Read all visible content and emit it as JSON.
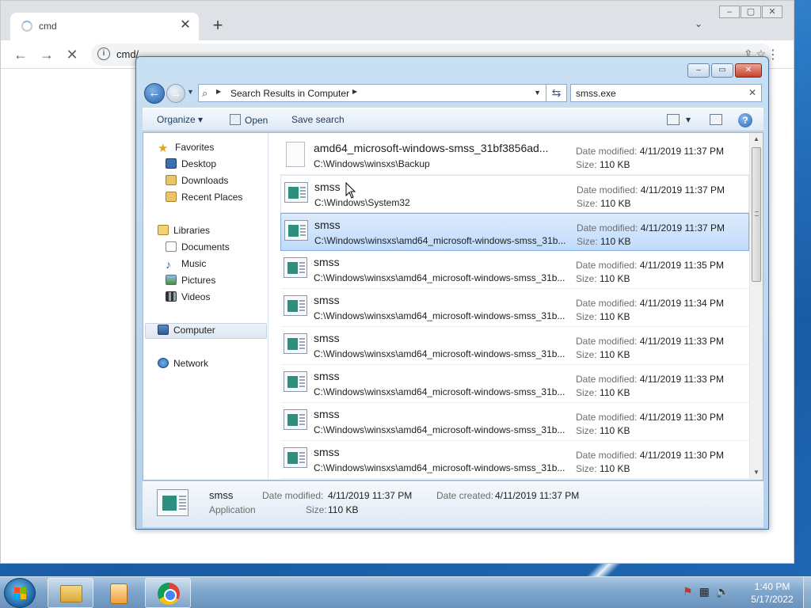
{
  "browser": {
    "tab_title": "cmd",
    "tab_close": "✕",
    "new_tab": "+",
    "tab_dropdown": "⌄",
    "url": "cmd/",
    "info_icon": "i"
  },
  "explorer": {
    "address_crumb": "Search Results in Computer",
    "search_value": "smss.exe",
    "toolbar": {
      "organize": "Organize",
      "open": "Open",
      "save_search": "Save search"
    },
    "nav": {
      "favorites": "Favorites",
      "desktop": "Desktop",
      "downloads": "Downloads",
      "recent_places": "Recent Places",
      "libraries": "Libraries",
      "documents": "Documents",
      "music": "Music",
      "pictures": "Pictures",
      "videos": "Videos",
      "computer": "Computer",
      "network": "Network"
    },
    "meta_labels": {
      "date_modified": "Date modified:",
      "size": "Size:"
    },
    "results": [
      {
        "name": "amd64_microsoft-windows-smss_31bf3856ad...",
        "path": "C:\\Windows\\winsxs\\Backup",
        "date": "4/11/2019 11:37 PM",
        "size": "110 KB"
      },
      {
        "name": "smss",
        "path": "C:\\Windows\\System32",
        "date": "4/11/2019 11:37 PM",
        "size": "110 KB"
      },
      {
        "name": "smss",
        "path": "C:\\Windows\\winsxs\\amd64_microsoft-windows-smss_31b...",
        "date": "4/11/2019 11:37 PM",
        "size": "110 KB"
      },
      {
        "name": "smss",
        "path": "C:\\Windows\\winsxs\\amd64_microsoft-windows-smss_31b...",
        "date": "4/11/2019 11:35 PM",
        "size": "110 KB"
      },
      {
        "name": "smss",
        "path": "C:\\Windows\\winsxs\\amd64_microsoft-windows-smss_31b...",
        "date": "4/11/2019 11:34 PM",
        "size": "110 KB"
      },
      {
        "name": "smss",
        "path": "C:\\Windows\\winsxs\\amd64_microsoft-windows-smss_31b...",
        "date": "4/11/2019 11:33 PM",
        "size": "110 KB"
      },
      {
        "name": "smss",
        "path": "C:\\Windows\\winsxs\\amd64_microsoft-windows-smss_31b...",
        "date": "4/11/2019 11:33 PM",
        "size": "110 KB"
      },
      {
        "name": "smss",
        "path": "C:\\Windows\\winsxs\\amd64_microsoft-windows-smss_31b...",
        "date": "4/11/2019 11:30 PM",
        "size": "110 KB"
      },
      {
        "name": "smss",
        "path": "C:\\Windows\\winsxs\\amd64_microsoft-windows-smss_31b...",
        "date": "4/11/2019 11:30 PM",
        "size": "110 KB"
      }
    ],
    "details": {
      "name": "smss",
      "type": "Application",
      "date_modified_label": "Date modified:",
      "date_modified": "4/11/2019 11:37 PM",
      "date_created_label": "Date created:",
      "date_created": "4/11/2019 11:37 PM",
      "size_label": "Size:",
      "size": "110 KB"
    }
  },
  "taskbar": {
    "time": "1:40 PM",
    "date": "5/17/2022"
  }
}
